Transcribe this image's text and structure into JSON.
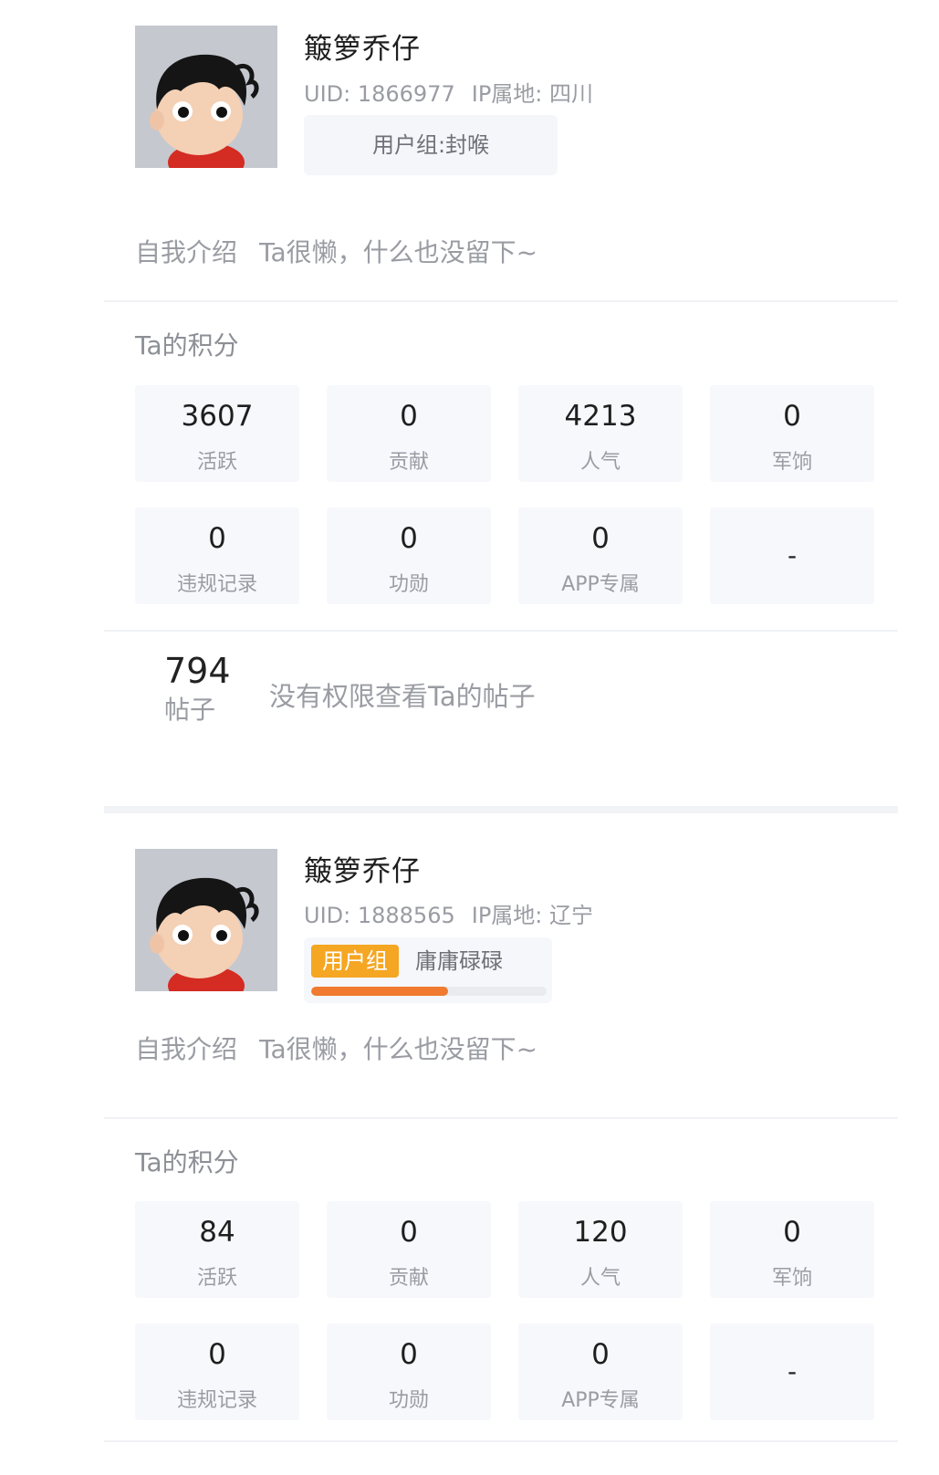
{
  "cards": [
    {
      "username": "簸箩乔仔",
      "uid": "UID: 1866977",
      "ip": "IP属地: 四川",
      "group_text": "用户组:封喉",
      "intro_label": "自我介绍",
      "intro_text": "Ta很懒，什么也没留下~",
      "score_title": "Ta的积分",
      "stats": [
        {
          "value": "3607",
          "label": "活跃"
        },
        {
          "value": "0",
          "label": "贡献"
        },
        {
          "value": "4213",
          "label": "人气"
        },
        {
          "value": "0",
          "label": "军饷"
        },
        {
          "value": "0",
          "label": "违规记录"
        },
        {
          "value": "0",
          "label": "功勋"
        },
        {
          "value": "0",
          "label": "APP专属"
        },
        {
          "value": "-",
          "label": ""
        }
      ],
      "posts_count": "794",
      "posts_label": "帖子",
      "posts_message": "没有权限查看Ta的帖子"
    },
    {
      "username": "簸箩乔仔",
      "uid": "UID: 1888565",
      "ip": "IP属地: 辽宁",
      "group_badge": "用户组",
      "group_name": "庸庸碌碌",
      "group_progress_fraction": 0.58,
      "intro_label": "自我介绍",
      "intro_text": "Ta很懒，什么也没留下~",
      "score_title": "Ta的积分",
      "stats": [
        {
          "value": "84",
          "label": "活跃"
        },
        {
          "value": "0",
          "label": "贡献"
        },
        {
          "value": "120",
          "label": "人气"
        },
        {
          "value": "0",
          "label": "军饷"
        },
        {
          "value": "0",
          "label": "违规记录"
        },
        {
          "value": "0",
          "label": "功勋"
        },
        {
          "value": "0",
          "label": "APP专属"
        },
        {
          "value": "-",
          "label": ""
        }
      ]
    }
  ],
  "colors": {
    "badge": "#f5a623",
    "progress": "#f07a2f",
    "cell_bg": "#f7f8fc",
    "muted_text": "#9a9ca3"
  },
  "icons": {
    "avatar": "cartoon-boy-avatar"
  }
}
